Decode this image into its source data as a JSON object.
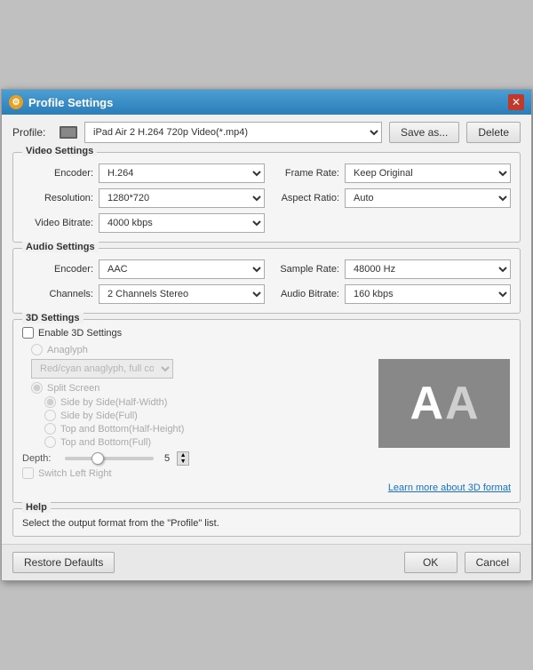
{
  "window": {
    "title": "Profile Settings",
    "icon": "⚙",
    "close_label": "✕"
  },
  "profile": {
    "label": "Profile:",
    "value": "iPad Air 2 H.264 720p Video(*.mp4)",
    "save_as_label": "Save as...",
    "delete_label": "Delete"
  },
  "video_settings": {
    "section_title": "Video Settings",
    "encoder_label": "Encoder:",
    "encoder_value": "H.264",
    "frame_rate_label": "Frame Rate:",
    "frame_rate_value": "Keep Original",
    "resolution_label": "Resolution:",
    "resolution_value": "1280*720",
    "aspect_ratio_label": "Aspect Ratio:",
    "aspect_ratio_value": "Auto",
    "video_bitrate_label": "Video Bitrate:",
    "video_bitrate_value": "4000 kbps"
  },
  "audio_settings": {
    "section_title": "Audio Settings",
    "encoder_label": "Encoder:",
    "encoder_value": "AAC",
    "sample_rate_label": "Sample Rate:",
    "sample_rate_value": "48000 Hz",
    "channels_label": "Channels:",
    "channels_value": "2 Channels Stereo",
    "audio_bitrate_label": "Audio Bitrate:",
    "audio_bitrate_value": "160 kbps"
  },
  "settings_3d": {
    "section_title": "3D Settings",
    "enable_label": "Enable 3D Settings",
    "anaglyph_label": "Anaglyph",
    "anaglyph_option": "Red/cyan anaglyph, full color",
    "split_screen_label": "Split Screen",
    "side_by_side_half_label": "Side by Side(Half-Width)",
    "side_by_side_full_label": "Side by Side(Full)",
    "top_bottom_half_label": "Top and Bottom(Half-Height)",
    "top_bottom_full_label": "Top and Bottom(Full)",
    "depth_label": "Depth:",
    "depth_value": "5",
    "switch_left_right_label": "Switch Left Right",
    "learn_more_label": "Learn more about 3D format",
    "aa_preview_left": "A",
    "aa_preview_right": "A"
  },
  "help": {
    "section_title": "Help",
    "text": "Select the output format from the \"Profile\" list."
  },
  "footer": {
    "restore_label": "Restore Defaults",
    "ok_label": "OK",
    "cancel_label": "Cancel"
  }
}
